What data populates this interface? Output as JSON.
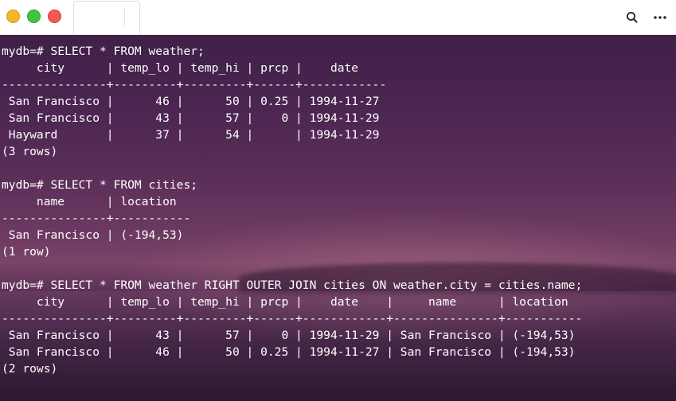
{
  "toolbar": {
    "search_icon": "search-icon",
    "more_icon": "more-icon"
  },
  "colors": {
    "close": "#ef5a52",
    "minimize": "#f5b728",
    "maximize": "#3fc43f",
    "text": "#ffffff"
  },
  "terminal": {
    "lines": [
      "mydb=# SELECT * FROM weather;",
      "     city      | temp_lo | temp_hi | prcp |    date",
      "---------------+---------+---------+------+------------",
      " San Francisco |      46 |      50 | 0.25 | 1994-11-27",
      " San Francisco |      43 |      57 |    0 | 1994-11-29",
      " Hayward       |      37 |      54 |      | 1994-11-29",
      "(3 rows)",
      "",
      "mydb=# SELECT * FROM cities;",
      "     name      | location",
      "---------------+-----------",
      " San Francisco | (-194,53)",
      "(1 row)",
      "",
      "mydb=# SELECT * FROM weather RIGHT OUTER JOIN cities ON weather.city = cities.name;",
      "     city      | temp_lo | temp_hi | prcp |    date    |     name      | location",
      "---------------+---------+---------+------+------------+---------------+-----------",
      " San Francisco |      43 |      57 |    0 | 1994-11-29 | San Francisco | (-194,53)",
      " San Francisco |      46 |      50 | 0.25 | 1994-11-27 | San Francisco | (-194,53)",
      "(2 rows)"
    ]
  }
}
